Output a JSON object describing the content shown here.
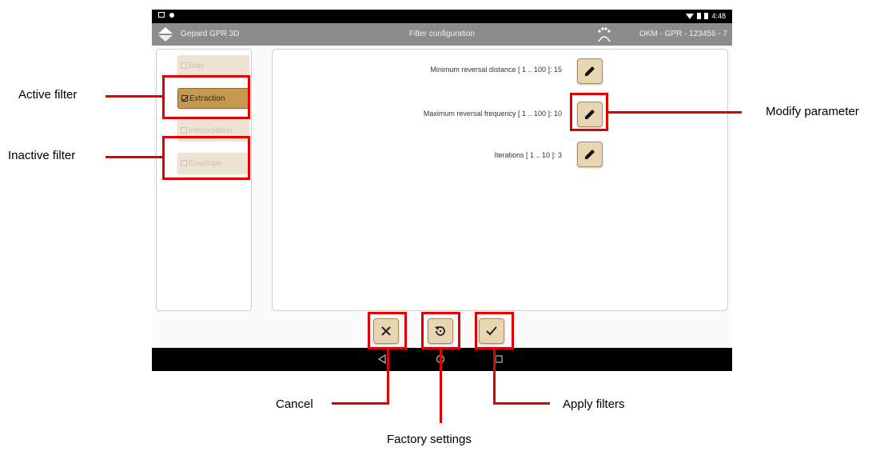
{
  "app": {
    "name": "Gepard GPR 3D",
    "screen_title": "Filter configuration",
    "device_id": "OKM - GPR - 123456 - 7",
    "status_time": "4:48"
  },
  "filters": [
    {
      "label": "Bias",
      "checked": false,
      "active": false
    },
    {
      "label": "Extraction",
      "checked": true,
      "active": true
    },
    {
      "label": "Interpolation",
      "checked": false,
      "active": false
    },
    {
      "label": "Envelope",
      "checked": false,
      "active": false
    }
  ],
  "parameters": [
    {
      "label": "Minimum reversal distance [ 1 .. 100 ]: 15"
    },
    {
      "label": "Maximum reversal frequency [ 1 .. 100 ]: 10"
    },
    {
      "label": "Iterations [ 1 .. 10 ]: 3"
    }
  ],
  "actions": {
    "cancel_icon": "close-icon",
    "reset_icon": "reset-icon",
    "apply_icon": "check-icon"
  },
  "annotations": {
    "active_filter": "Active filter",
    "inactive_filter": "Inactive filter",
    "modify_parameter": "Modify parameter",
    "cancel": "Cancel",
    "factory_settings": "Factory settings",
    "apply_filters": "Apply filters"
  },
  "colors": {
    "accent_red": "#e00000",
    "button_fill": "#e8d6b2",
    "active_filter_fill": "#c69a4e",
    "app_bar": "#8c8c8c"
  }
}
